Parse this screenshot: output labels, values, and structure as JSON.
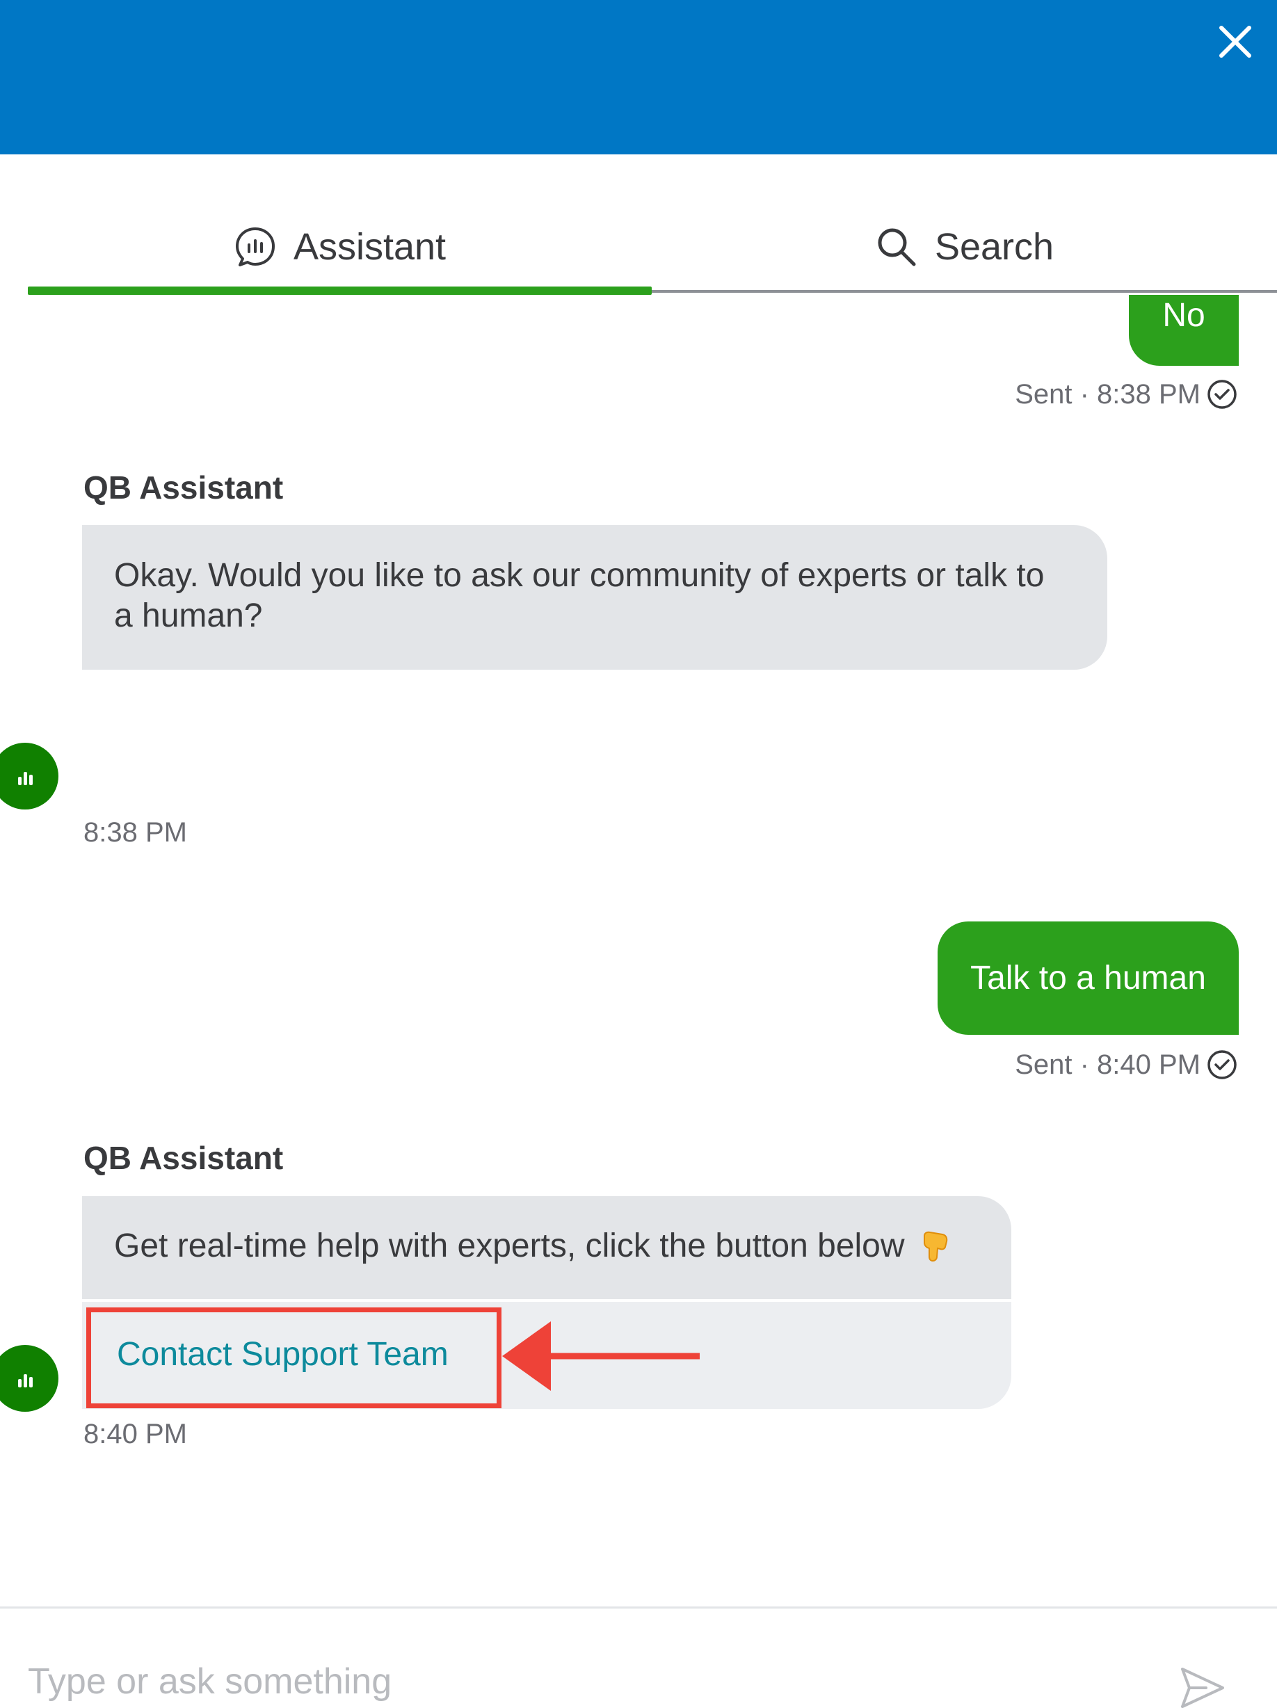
{
  "header": {
    "close_icon": "close-icon",
    "background_color": "#0077c5"
  },
  "tabs": [
    {
      "label": "Assistant",
      "icon": "assistant-chat-icon",
      "active": true
    },
    {
      "label": "Search",
      "icon": "search-icon",
      "active": false
    }
  ],
  "messages": {
    "user_1": {
      "text": "No",
      "meta": "Sent · 8:38 PM",
      "status_icon": "check-circle-icon"
    },
    "bot_1": {
      "sender": "QB Assistant",
      "text": "Okay. Would you like to ask our community of experts or talk to a human?",
      "time": "8:38 PM"
    },
    "user_2": {
      "text": "Talk to a human",
      "meta": "Sent · 8:40 PM",
      "status_icon": "check-circle-icon"
    },
    "bot_2": {
      "sender": "QB Assistant",
      "text": "Get real-time help with experts, click the button below",
      "emoji": "pointing-down-hand-icon",
      "link_label": "Contact Support Team",
      "time": "8:40 PM"
    }
  },
  "annotation": {
    "highlight_color": "#ee4238",
    "arrow_icon": "arrow-left-icon"
  },
  "composer": {
    "placeholder": "Type or ask something",
    "send_icon": "send-icon"
  },
  "colors": {
    "accent_green": "#2ca01c",
    "bot_bubble": "#e3e5e8",
    "link_teal": "#0d8a9c"
  }
}
